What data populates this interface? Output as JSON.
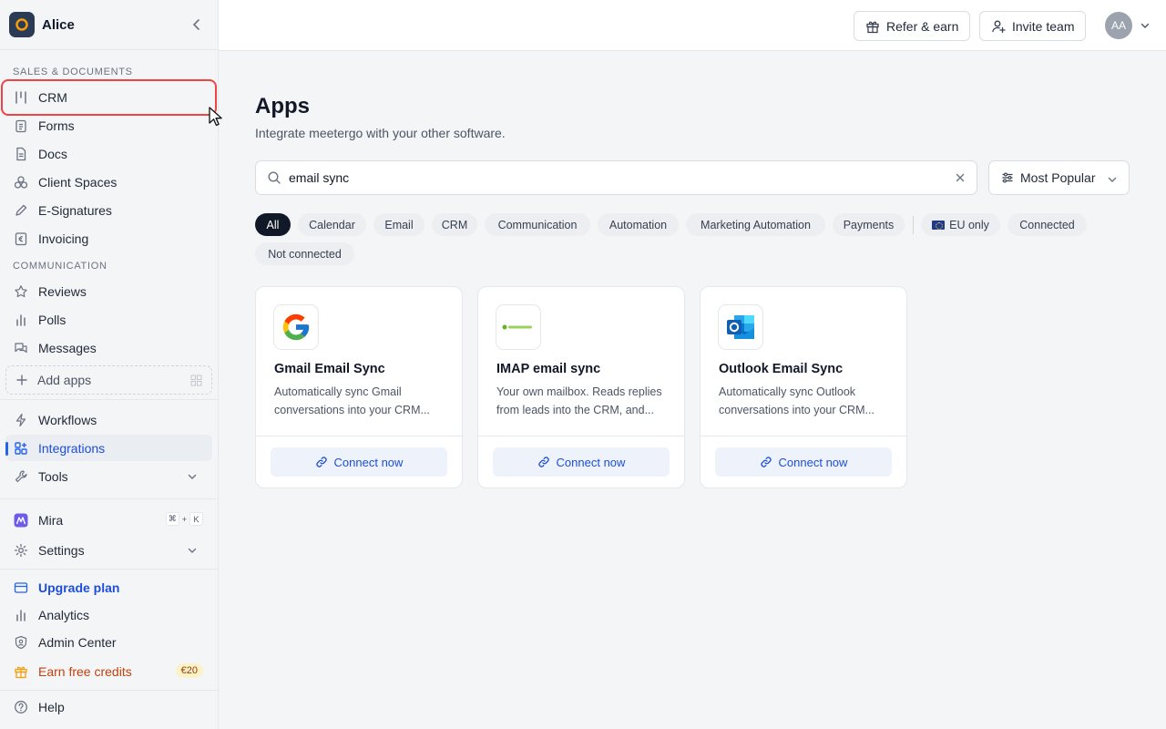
{
  "workspace": {
    "name": "Alice"
  },
  "sidebar": {
    "sections": {
      "sales": "SALES & DOCUMENTS",
      "communication": "COMMUNICATION"
    },
    "sales_items": [
      {
        "label": "CRM",
        "icon": "crm-icon"
      },
      {
        "label": "Forms",
        "icon": "clipboard-icon"
      },
      {
        "label": "Docs",
        "icon": "document-icon"
      },
      {
        "label": "Client Spaces",
        "icon": "cubes-icon"
      },
      {
        "label": "E-Signatures",
        "icon": "pen-icon"
      },
      {
        "label": "Invoicing",
        "icon": "euro-icon"
      }
    ],
    "communication_items": [
      {
        "label": "Reviews",
        "icon": "star-icon"
      },
      {
        "label": "Polls",
        "icon": "bar-chart-icon"
      },
      {
        "label": "Messages",
        "icon": "chat-icon"
      }
    ],
    "add_apps": "Add apps",
    "tools_items": [
      {
        "label": "Workflows",
        "icon": "bolt-icon"
      },
      {
        "label": "Integrations",
        "icon": "apps-icon"
      },
      {
        "label": "Tools",
        "icon": "wrench-icon"
      }
    ],
    "mira": {
      "label": "Mira",
      "shortcut_mod": "⌘",
      "shortcut_plus": "+",
      "shortcut_key": "K"
    },
    "settings": "Settings",
    "upgrade": "Upgrade plan",
    "analytics": "Analytics",
    "admin_center": "Admin Center",
    "earn_credits": "Earn free credits",
    "credit_badge": "€20",
    "help": "Help"
  },
  "header": {
    "refer": "Refer & earn",
    "invite": "Invite team",
    "avatar_initials": "AA"
  },
  "main": {
    "title": "Apps",
    "subtitle": "Integrate meetergo with your other software.",
    "search": {
      "value": "email sync"
    },
    "sort": "Most Popular",
    "filters": [
      "All",
      "Calendar",
      "Email",
      "CRM",
      "Communication",
      "Automation",
      "Marketing Automation",
      "Payments",
      "EU only",
      "Connected",
      "Not connected"
    ],
    "cards": [
      {
        "title": "Gmail Email Sync",
        "desc1": "Automatically sync Gmail",
        "desc2": "conversations into your CRM...",
        "action": "Connect now",
        "logo": "google-logo-icon"
      },
      {
        "title": "IMAP email sync",
        "desc1": "Your own mailbox. Reads replies",
        "desc2": "from leads into the CRM, and...",
        "action": "Connect now",
        "logo": "mailbox-org-logo-icon"
      },
      {
        "title": "Outlook Email Sync",
        "desc1": "Automatically sync Outlook",
        "desc2": "conversations into your CRM...",
        "action": "Connect now",
        "logo": "outlook-logo-icon"
      }
    ]
  },
  "colors": {
    "accent": "#2563eb",
    "highlight": "#ef4444",
    "credits": "#d97706"
  }
}
